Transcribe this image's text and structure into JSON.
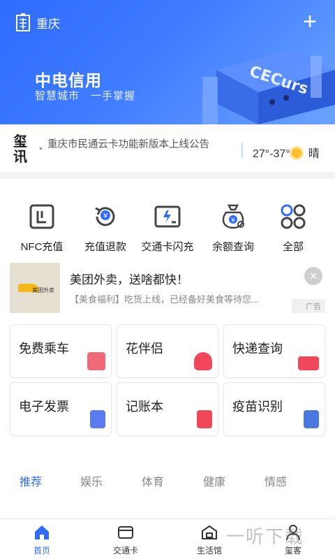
{
  "header": {
    "city": "重庆",
    "title": "中电信用",
    "subtitle": "智慧城市　一手掌握",
    "add_label": "+",
    "art_text": "CECurs"
  },
  "notice": {
    "logo_text": "玺讯",
    "headline": "重庆市民通云卡功能新版本上线公告",
    "temperature": "27°-37°",
    "condition": "晴"
  },
  "services": [
    {
      "label": "NFC充值",
      "icon": "nfc-icon"
    },
    {
      "label": "充值退款",
      "icon": "refund-icon"
    },
    {
      "label": "交通卡闪充",
      "icon": "flash-charge-icon"
    },
    {
      "label": "余额查询",
      "icon": "balance-query-icon"
    },
    {
      "label": "全部",
      "icon": "all-grid-icon"
    }
  ],
  "ad": {
    "thumb_text": "美团外卖",
    "title": "美团外卖，送啥都快！",
    "description": "【美食福利】吃货上线，已经备好美食等待您...",
    "tag": "广告"
  },
  "tiles": [
    {
      "label": "免费乘车",
      "icon": "free-ride-icon",
      "color": "#f06a7a"
    },
    {
      "label": "花伴侣",
      "icon": "flower-icon",
      "color": "#f0485a"
    },
    {
      "label": "快递查询",
      "icon": "truck-icon",
      "color": "#f0485a"
    },
    {
      "label": "电子发票",
      "icon": "invoice-icon",
      "color": "#5a7cf0"
    },
    {
      "label": "记账本",
      "icon": "ledger-icon",
      "color": "#f0485a"
    },
    {
      "label": "疫苗识别",
      "icon": "vaccine-book-icon",
      "color": "#4a78e0"
    }
  ],
  "tabs": [
    "推荐",
    "娱乐",
    "体育",
    "健康",
    "情感"
  ],
  "bottom_nav": [
    {
      "label": "首页",
      "icon": "home-icon"
    },
    {
      "label": "交通卡",
      "icon": "card-icon"
    },
    {
      "label": "生活馆",
      "icon": "life-hall-icon"
    },
    {
      "label": "玺客",
      "icon": "user-icon"
    }
  ],
  "watermark": "一听下载",
  "colors": {
    "accent": "#2f6bff",
    "banner": "#3f7cff"
  }
}
